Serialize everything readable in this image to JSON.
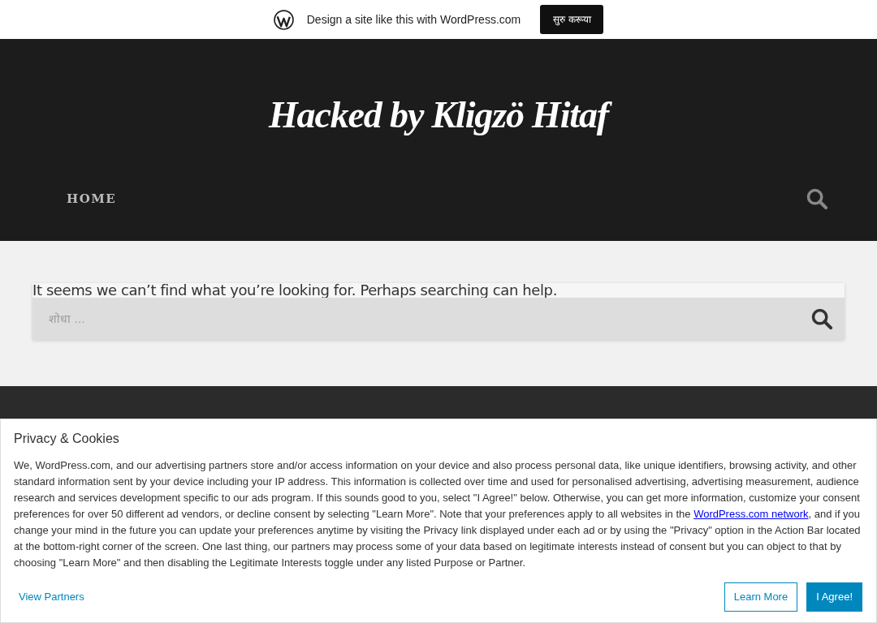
{
  "promo_bar": {
    "text": "Design a site like this with WordPress.com",
    "button": "सुरु करूया"
  },
  "header": {
    "site_title": "Hacked by Kligzö Hitaf",
    "nav": [
      {
        "label": "HOME"
      }
    ]
  },
  "content": {
    "message": "It seems we can’t find what you’re looking for. Perhaps searching can help.",
    "search": {
      "placeholder": "शोधा …"
    }
  },
  "cookie_banner": {
    "title": "Privacy & Cookies",
    "text_before": "We, WordPress.com, and our advertising partners store and/or access information on your device and also process personal data, like unique identifiers, browsing activity, and other standard information sent by your device including your IP address. This information is collected over time and used for personalised advertising, advertising measurement, audience research and services development specific to our ads program. If this sounds good to you, select \"I Agree!\" below. Otherwise, you can get more information, customize your consent preferences for over 50 different ad vendors, or decline consent by selecting \"Learn More\". Note that your preferences apply to all websites in the ",
    "link": "WordPress.com network",
    "text_after": ", and if you change your mind in the future you can update your preferences anytime by visiting the Privacy link displayed under each ad or by using the \"Privacy\" option in the Action Bar located at the bottom-right corner of the screen. One last thing, our partners may process some of your data based on legitimate interests instead of consent but you can object to that by choosing \"Learn More\" and then disabling the Legitimate Interests toggle under any listed Purpose or Partner.",
    "view_partners": "View Partners",
    "learn_more": "Learn More",
    "agree": "I Agree!"
  }
}
